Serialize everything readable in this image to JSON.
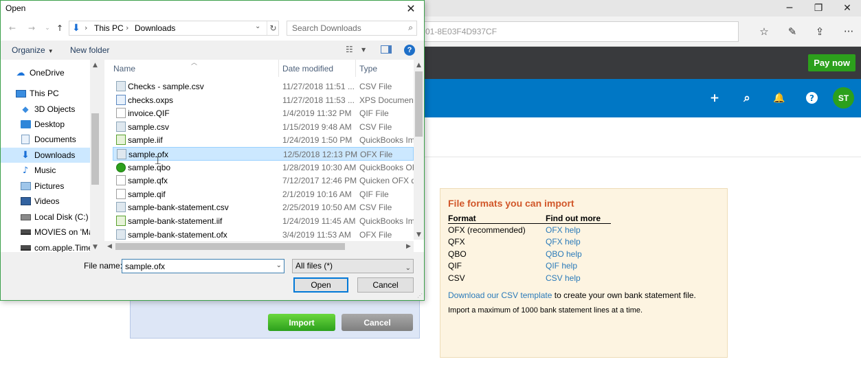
{
  "browser": {
    "url_fragment": "01-8E03F4D937CF",
    "controls": {
      "minimize": "─",
      "maximize": "❐",
      "close": "✕"
    },
    "tools": [
      "☆",
      "✎",
      "⇪",
      "···"
    ]
  },
  "app": {
    "pay_now": "Pay now",
    "header_icons": {
      "add": "+",
      "search": "⌕",
      "bell": "🔔",
      "help": "?"
    },
    "avatar_initials": "ST",
    "import_button": "Import",
    "cancel_button": "Cancel",
    "accent_color": "#2ca01c",
    "header_color": "#0077c5"
  },
  "formats_box": {
    "title": "File formats you can import",
    "col_format": "Format",
    "col_more": "Find out more",
    "rows": [
      {
        "format": "OFX (recommended)",
        "help": "OFX help"
      },
      {
        "format": "QFX",
        "help": "QFX help"
      },
      {
        "format": "QBO",
        "help": "QBO help"
      },
      {
        "format": "QIF",
        "help": "QIF help"
      },
      {
        "format": "CSV",
        "help": "CSV help"
      }
    ],
    "template_link": "Download our CSV template",
    "template_rest": " to create your own bank statement file.",
    "limit_note": "Import a maximum of 1000 bank statement lines at a time."
  },
  "dialog": {
    "title": "Open",
    "close": "✕",
    "path": {
      "pc": "This PC",
      "folder": "Downloads",
      "sep": "›"
    },
    "search_placeholder": "Search Downloads",
    "organize": "Organize",
    "new_folder": "New folder",
    "help": "?",
    "nav_items": [
      {
        "label": "OneDrive"
      },
      {
        "label": "This PC"
      },
      {
        "label": "3D Objects"
      },
      {
        "label": "Desktop"
      },
      {
        "label": "Documents"
      },
      {
        "label": "Downloads"
      },
      {
        "label": "Music"
      },
      {
        "label": "Pictures"
      },
      {
        "label": "Videos"
      },
      {
        "label": "Local Disk (C:)"
      },
      {
        "label": "MOVIES on 'Mac"
      },
      {
        "label": "com.apple.Time"
      }
    ],
    "columns": {
      "name": "Name",
      "date": "Date modified",
      "type": "Type"
    },
    "files": [
      {
        "name": "Checks - sample.csv",
        "date": "11/27/2018 11:51 ...",
        "type": "CSV File",
        "icon": "csv"
      },
      {
        "name": "checks.oxps",
        "date": "11/27/2018 11:53 ...",
        "type": "XPS Document",
        "icon": "oxps"
      },
      {
        "name": "invoice.QIF",
        "date": "1/4/2019 11:32 PM",
        "type": "QIF File",
        "icon": "plain"
      },
      {
        "name": "sample.csv",
        "date": "1/15/2019 9:48 AM",
        "type": "CSV File",
        "icon": "csv"
      },
      {
        "name": "sample.iif",
        "date": "1/24/2019 1:50 PM",
        "type": "QuickBooks Imp",
        "icon": "iif"
      },
      {
        "name": "sample.ofx",
        "date": "12/5/2018 12:13 PM",
        "type": "OFX File",
        "icon": "csv"
      },
      {
        "name": "sample.qbo",
        "date": "1/28/2019 10:30 AM",
        "type": "QuickBooks OFX",
        "icon": "qbo"
      },
      {
        "name": "sample.qfx",
        "date": "7/12/2017 12:46 PM",
        "type": "Quicken OFX da",
        "icon": "plain"
      },
      {
        "name": "sample.qif",
        "date": "2/1/2019 10:16 AM",
        "type": "QIF File",
        "icon": "plain"
      },
      {
        "name": "sample-bank-statement.csv",
        "date": "2/25/2019 10:50 AM",
        "type": "CSV File",
        "icon": "csv"
      },
      {
        "name": "sample-bank-statement.iif",
        "date": "1/24/2019 11:45 AM",
        "type": "QuickBooks Imp",
        "icon": "iif"
      },
      {
        "name": "sample-bank-statement.ofx",
        "date": "3/4/2019 11:53 AM",
        "type": "OFX File",
        "icon": "csv"
      }
    ],
    "selected_file": "sample.ofx",
    "file_name_label": "File name:",
    "file_name_value": "sample.ofx",
    "file_type": "All files (*)",
    "open_button": "Open",
    "cancel_button": "Cancel"
  }
}
